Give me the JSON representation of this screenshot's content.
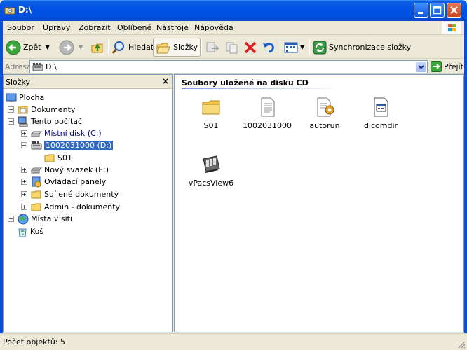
{
  "window": {
    "title": "D:\\"
  },
  "menu": [
    {
      "accel": "S",
      "rest": "oubor"
    },
    {
      "accel": "Ú",
      "rest": "pravy"
    },
    {
      "accel": "Z",
      "rest": "obrazit"
    },
    {
      "accel": "O",
      "rest": "blíbené"
    },
    {
      "accel": "N",
      "rest": "ástroje"
    },
    {
      "accel": "",
      "rest": "Nápověda"
    }
  ],
  "toolbar": {
    "back_label": "Zpět",
    "search_label": "Hledat",
    "folders_label": "Složky",
    "sync_label": "Synchronizace složky"
  },
  "address": {
    "label": "Adresa",
    "value": "D:\\",
    "go_label": "Přejít"
  },
  "folders_pane": {
    "title": "Složky",
    "close": "×",
    "items": [
      {
        "label": "Plocha"
      },
      {
        "label": "Dokumenty"
      },
      {
        "label": "Tento počítač"
      },
      {
        "label": "Místní disk (C:)"
      },
      {
        "label": "1002031000 (D:)"
      },
      {
        "label": "S01"
      },
      {
        "label": "Nový svazek (E:)"
      },
      {
        "label": "Ovládací panely"
      },
      {
        "label": "Sdílené dokumenty"
      },
      {
        "label": "Admin - dokumenty"
      },
      {
        "label": "Místa v síti"
      },
      {
        "label": "Koš"
      }
    ]
  },
  "content": {
    "section_title": "Soubory uložené na disku CD",
    "files": [
      {
        "name": "S01",
        "icon": "folder-icon"
      },
      {
        "name": "1002031000",
        "icon": "text-file-icon"
      },
      {
        "name": "autorun",
        "icon": "autorun-icon"
      },
      {
        "name": "dicomdir",
        "icon": "dicomdir-icon"
      },
      {
        "name": "vPacsView6",
        "icon": "application-icon"
      }
    ]
  },
  "status": {
    "text": "Počet objektů: 5"
  },
  "colors": {
    "title_bar": "#0053e6",
    "selection": "#316ac5",
    "window_bg": "#ece9d8"
  }
}
